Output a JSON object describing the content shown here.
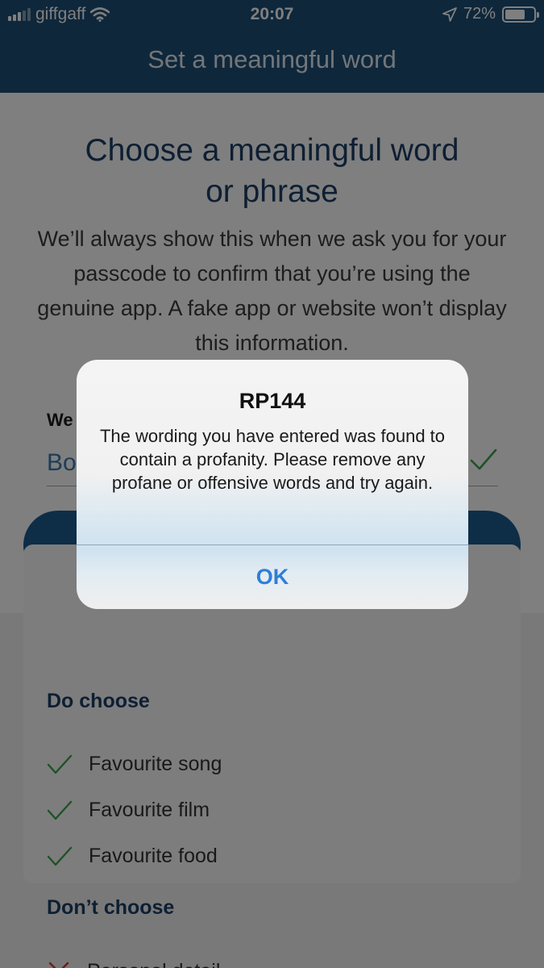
{
  "status_bar": {
    "carrier": "giffgaff",
    "time": "20:07",
    "battery_percent_label": "72%",
    "battery_level": 0.72,
    "signal_bars_filled": 3,
    "signal_bars_total": 5
  },
  "nav": {
    "title": "Set a meaningful word"
  },
  "main": {
    "heading_line1": "Choose a meaningful word",
    "heading_line2": "or phrase",
    "description": "We’ll always show this when we ask you for your passcode to confirm that you’re using the genuine app. A fake app or website won’t display this information.",
    "field_label_visible": "We",
    "field_value_visible": "Bo"
  },
  "do_choose": {
    "heading": "Do choose",
    "items": [
      "Favourite song",
      "Favourite film",
      "Favourite food"
    ]
  },
  "dont_choose": {
    "heading": "Don’t choose",
    "first_item_visible": "Personal detail"
  },
  "alert": {
    "title": "RP144",
    "message": "The wording you have entered was found to contain a profanity. Please remove any profane or offensive words and try again.",
    "ok_label": "OK"
  },
  "colors": {
    "brand_navy": "#1c4f77",
    "button_blue": "#1c5a8e",
    "heading_blue": "#1c3f66",
    "check_green": "#3fa34d",
    "cross_red": "#d33b32",
    "ios_link_blue": "#2f7ed8"
  },
  "icons": [
    "wifi-icon",
    "location-arrow-icon",
    "battery-icon",
    "checkmark-icon",
    "cross-icon"
  ]
}
